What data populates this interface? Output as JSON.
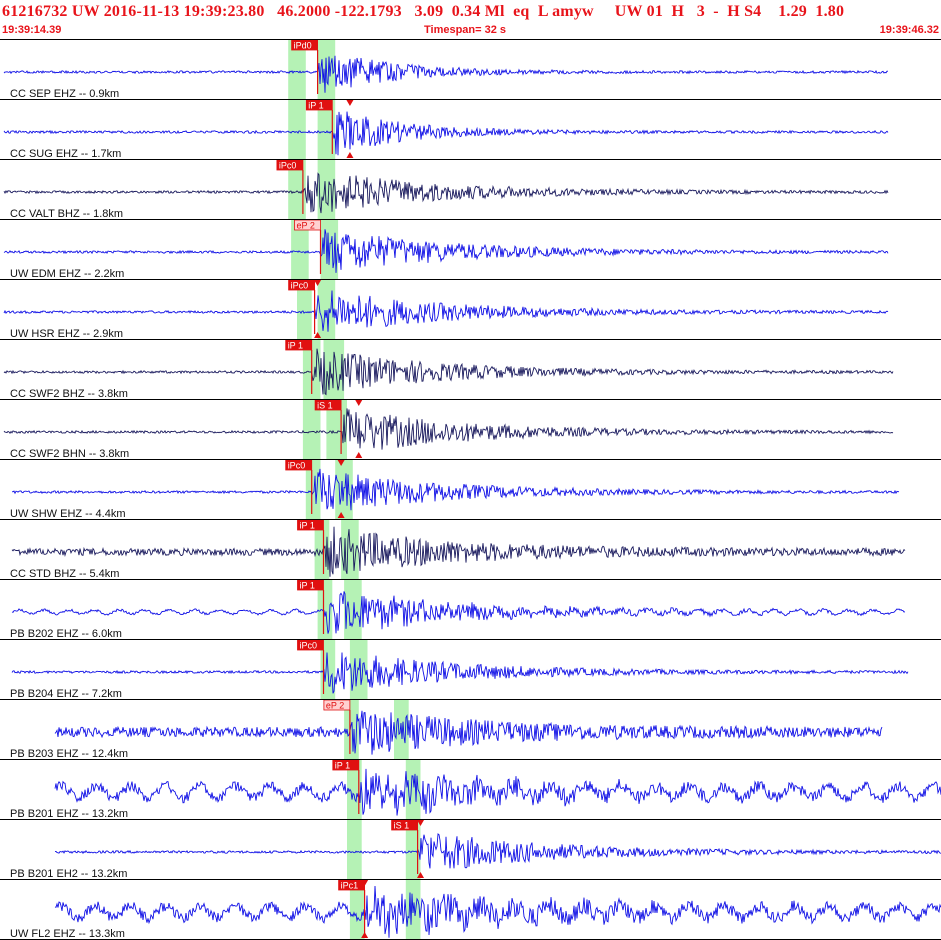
{
  "header": {
    "event_id": "61216732",
    "network": "UW",
    "origin_datetime": "2016-11-13 19:39:23.80",
    "latitude": "46.2000",
    "longitude": "-122.1793",
    "depth": "3.09",
    "magnitude": "0.34 Ml",
    "event_type": "eq",
    "flag": "L",
    "author": "amyw",
    "quality_fields": "UW 01  H   3  -  H S4",
    "value_a": "1.29",
    "value_b": "1.80",
    "start_time": "19:39:14.39",
    "timespan": "Timespan=  32 s",
    "end_time": "19:39:46.32"
  },
  "colors": {
    "header_text": "#e8141b",
    "trace_blue": "#1010e6",
    "trace_navy": "#1a1a5e",
    "pick_red": "#e01010",
    "window_green": "#a8f0a8",
    "channel_label": "#101010"
  },
  "chart_data": {
    "type": "line",
    "title": "",
    "time_range_s": [
      0,
      32
    ],
    "time_axis": "seconds since 19:39:14.39",
    "channels": [
      {
        "label": "CC SEP EHZ -- 0.9km",
        "color": "blue",
        "pick": {
          "label": "iPd0",
          "t": 10.8
        },
        "s_marker": null,
        "trace_end_t": 30.2,
        "green_windows": [
          [
            9.8,
            10.4
          ],
          [
            10.8,
            11.4
          ]
        ]
      },
      {
        "label": "CC SUG EHZ -- 1.7km",
        "color": "blue",
        "pick": {
          "label": "iP 1",
          "t": 11.3
        },
        "s_marker": 11.9,
        "trace_end_t": 30.2,
        "green_windows": [
          [
            9.8,
            10.4
          ],
          [
            10.8,
            11.4
          ]
        ]
      },
      {
        "label": "CC VALT BHZ -- 1.8km",
        "color": "navy",
        "pick": {
          "label": "iPc0",
          "t": 10.3
        },
        "s_marker": null,
        "trace_end_t": 30.2,
        "green_windows": [
          [
            9.8,
            10.4
          ],
          [
            10.8,
            11.4
          ]
        ]
      },
      {
        "label": "UW EDM EHZ -- 2.2km",
        "color": "blue",
        "pick": {
          "label": "eP 2",
          "t": 10.9
        },
        "s_marker": null,
        "trace_end_t": 30.2,
        "green_windows": [
          [
            9.9,
            10.5
          ],
          [
            10.9,
            11.5
          ]
        ]
      },
      {
        "label": "UW HSR EHZ -- 2.9km",
        "color": "blue",
        "pick": {
          "label": "iPc0",
          "t": 10.7
        },
        "s_marker": 10.8,
        "trace_end_t": 30.2,
        "green_windows": [
          [
            10.1,
            10.6
          ],
          [
            10.8,
            11.4
          ]
        ]
      },
      {
        "label": "CC SWF2 BHZ -- 3.8km",
        "color": "navy",
        "pick": {
          "label": "iP 1",
          "t": 10.6
        },
        "s_marker": null,
        "trace_end_t": 30.4,
        "green_windows": [
          [
            10.3,
            10.9
          ],
          [
            11.0,
            11.7
          ]
        ]
      },
      {
        "label": "CC SWF2 BHN -- 3.8km",
        "color": "navy",
        "pick": {
          "label": "iS 1",
          "t": 11.6
        },
        "s_marker": 12.2,
        "trace_end_t": 30.4,
        "green_windows": [
          [
            10.3,
            10.9
          ],
          [
            11.1,
            11.8
          ]
        ]
      },
      {
        "label": "UW SHW EHZ -- 4.4km",
        "color": "blue",
        "pick": {
          "label": "iPc0",
          "t": 10.6
        },
        "s_marker": 11.6,
        "trace_end_t": 30.6,
        "green_windows": [
          [
            10.4,
            10.9
          ],
          [
            11.4,
            12.0
          ]
        ]
      },
      {
        "label": "CC STD BHZ -- 5.4km",
        "color": "navy",
        "pick": {
          "label": "iP 1",
          "t": 11.0
        },
        "s_marker": null,
        "trace_end_t": 30.8,
        "green_windows": [
          [
            10.7,
            11.2
          ],
          [
            11.6,
            12.2
          ]
        ]
      },
      {
        "label": "PB B202 EHZ -- 6.0km",
        "color": "blue",
        "pick": {
          "label": "iP 1",
          "t": 11.0
        },
        "s_marker": null,
        "trace_end_t": 30.8,
        "green_windows": [
          [
            10.8,
            11.3
          ],
          [
            11.7,
            12.3
          ]
        ]
      },
      {
        "label": "PB B204 EHZ -- 7.2km",
        "color": "blue",
        "pick": {
          "label": "iPc0",
          "t": 11.0
        },
        "s_marker": null,
        "trace_end_t": 30.9,
        "green_windows": [
          [
            10.9,
            11.4
          ],
          [
            11.9,
            12.5
          ]
        ]
      },
      {
        "label": "PB B203 EHZ -- 12.4km",
        "color": "blue",
        "pick": {
          "label": "eP 2",
          "t": 11.9
        },
        "s_marker": null,
        "trace_end_t": 30.0,
        "green_windows": [
          [
            11.7,
            12.2
          ],
          [
            13.4,
            13.9
          ]
        ]
      },
      {
        "label": "PB B201 EHZ -- 13.2km",
        "color": "blue",
        "pick": {
          "label": "iP 1",
          "t": 12.2
        },
        "s_marker": null,
        "trace_end_t": 32.0,
        "green_windows": [
          [
            11.8,
            12.3
          ],
          [
            13.8,
            14.3
          ]
        ]
      },
      {
        "label": "PB B201 EH2 -- 13.2km",
        "color": "blue",
        "pick": {
          "label": "iS 1",
          "t": 14.2
        },
        "s_marker": 14.3,
        "trace_end_t": 32.0,
        "green_windows": [
          [
            11.8,
            12.3
          ],
          [
            13.8,
            14.3
          ]
        ]
      },
      {
        "label": "UW FL2 EHZ -- 13.3km",
        "color": "blue",
        "pick": {
          "label": "iPc1",
          "t": 12.4
        },
        "s_marker": 12.4,
        "trace_end_t": 32.0,
        "green_windows": [
          [
            11.9,
            12.4
          ],
          [
            13.8,
            14.3
          ]
        ]
      }
    ]
  }
}
